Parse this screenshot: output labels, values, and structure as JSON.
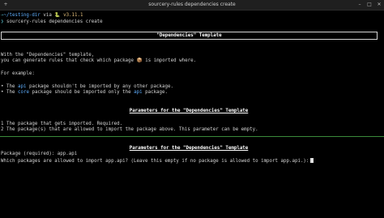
{
  "window": {
    "title": "sourcery-rules dependencies create"
  },
  "prompt": {
    "arrow": "→",
    "dir": "~/testing-dir",
    "via": "via",
    "python_icon": "🐍",
    "version": "v3.11.1",
    "command_prefix": "❯",
    "command": "sourcery-rules dependencies create"
  },
  "box": {
    "title": "\"Dependencies\" Template"
  },
  "intro": {
    "line1": "With the \"Dependencies\" template,",
    "line2_a": "you can generate rules that check which package",
    "line2_icon": "📦",
    "line2_b": "is imported where."
  },
  "example": {
    "heading": "For example:",
    "bullet": "•",
    "item1_a": "The",
    "item1_code": "api",
    "item1_b": "package shouldn't be imported by any other package.",
    "item2_a": "The",
    "item2_code": "core",
    "item2_b": "package should be imported only the",
    "item2_code2": "api",
    "item2_c": "package."
  },
  "parameters": {
    "heading": "Parameters for the \"Dependencies\" Template",
    "items": [
      {
        "num": "1",
        "text": "The package that gets imported. Required."
      },
      {
        "num": "2",
        "text": "The package(s) that are allowed to import the package above. This parameter can be empty."
      }
    ]
  },
  "parameters2": {
    "heading": "Parameters for the \"Dependencies\" Template",
    "package_line": "Package (required): app.api",
    "question": "Which packages are allowed to import app.api? (Leave this empty if no package is allowed to import app.api.):"
  }
}
